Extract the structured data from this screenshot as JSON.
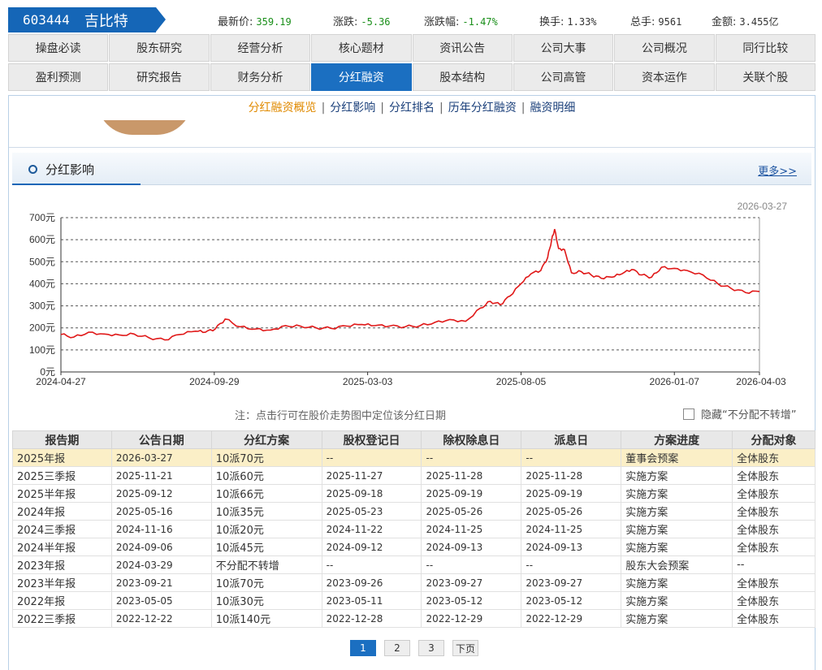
{
  "header": {
    "code": "603444",
    "name": "吉比特",
    "quotes": [
      {
        "label": "最新价:",
        "value": "359.19",
        "color": "green"
      },
      {
        "label": "涨跌:",
        "value": "-5.36",
        "color": "green"
      },
      {
        "label": "涨跌幅:",
        "value": "-1.47%",
        "color": "green"
      },
      {
        "label": "换手:",
        "value": "1.33%",
        "color": "plain"
      },
      {
        "label": "总手:",
        "value": "9561",
        "color": "plain"
      },
      {
        "label": "金额:",
        "value": "3.455亿",
        "color": "plain"
      }
    ]
  },
  "nav_row1": [
    "操盘必读",
    "股东研究",
    "经营分析",
    "核心题材",
    "资讯公告",
    "公司大事",
    "公司概况",
    "同行比较"
  ],
  "nav_row2": [
    "盈利预测",
    "研究报告",
    "财务分析",
    "分红融资",
    "股本结构",
    "公司高管",
    "资本运作",
    "关联个股"
  ],
  "nav_active": "分红融资",
  "subnav": [
    "分红融资概览",
    "分红影响",
    "分红排名",
    "历年分红融资",
    "融资明细"
  ],
  "section": {
    "title": "分红影响",
    "more": "更多>>"
  },
  "chart_data": {
    "type": "line",
    "date_label": "2026-03-27",
    "y_ticks": [
      "0元",
      "100元",
      "200元",
      "300元",
      "400元",
      "500元",
      "600元",
      "700元"
    ],
    "x_ticks": [
      "2024-04-27",
      "2024-09-29",
      "2025-03-03",
      "2025-08-05",
      "2026-01-07",
      "2026-04-03"
    ],
    "ylim": [
      0,
      700
    ],
    "grid": true,
    "line_color": "#e01818",
    "x_dates": [
      "2024-04-27",
      "2024-05-10",
      "2024-05-25",
      "2024-06-10",
      "2024-06-25",
      "2024-07-10",
      "2024-07-25",
      "2024-08-10",
      "2024-08-25",
      "2024-09-10",
      "2024-09-20",
      "2024-09-30",
      "2024-10-10",
      "2024-10-25",
      "2024-11-10",
      "2024-11-25",
      "2024-12-10",
      "2024-12-25",
      "2025-01-10",
      "2025-01-25",
      "2025-02-10",
      "2025-02-25",
      "2025-03-10",
      "2025-03-25",
      "2025-04-10",
      "2025-04-25",
      "2025-05-10",
      "2025-05-25",
      "2025-06-10",
      "2025-06-25",
      "2025-07-05",
      "2025-07-15",
      "2025-07-25",
      "2025-08-05",
      "2025-08-15",
      "2025-08-25",
      "2025-09-01",
      "2025-09-05",
      "2025-09-08",
      "2025-09-12",
      "2025-09-18",
      "2025-09-25",
      "2025-10-05",
      "2025-10-15",
      "2025-10-25",
      "2025-11-05",
      "2025-11-15",
      "2025-11-25",
      "2025-12-05",
      "2025-12-15",
      "2025-12-25",
      "2026-01-07",
      "2026-01-20",
      "2026-02-05",
      "2026-02-20",
      "2026-03-05",
      "2026-03-20",
      "2026-04-03"
    ],
    "values": [
      170,
      158,
      180,
      172,
      168,
      172,
      155,
      145,
      170,
      185,
      180,
      195,
      240,
      205,
      195,
      190,
      210,
      208,
      200,
      198,
      208,
      215,
      210,
      208,
      205,
      210,
      225,
      238,
      230,
      290,
      320,
      305,
      345,
      400,
      445,
      460,
      520,
      600,
      648,
      560,
      555,
      450,
      455,
      440,
      425,
      430,
      445,
      465,
      440,
      430,
      475,
      470,
      460,
      440,
      400,
      380,
      360,
      365
    ]
  },
  "note": "注：点击行可在股价走势图中定位该分红日期",
  "hide_label": "隐藏“不分配不转增”",
  "table": {
    "headers": [
      "报告期",
      "公告日期",
      "分红方案",
      "股权登记日",
      "除权除息日",
      "派息日",
      "方案进度",
      "分配对象"
    ],
    "rows": [
      [
        "2025年报",
        "2026-03-27",
        "10派70元",
        "--",
        "--",
        "--",
        "董事会预案",
        "全体股东"
      ],
      [
        "2025三季报",
        "2025-11-21",
        "10派60元",
        "2025-11-27",
        "2025-11-28",
        "2025-11-28",
        "实施方案",
        "全体股东"
      ],
      [
        "2025半年报",
        "2025-09-12",
        "10派66元",
        "2025-09-18",
        "2025-09-19",
        "2025-09-19",
        "实施方案",
        "全体股东"
      ],
      [
        "2024年报",
        "2025-05-16",
        "10派35元",
        "2025-05-23",
        "2025-05-26",
        "2025-05-26",
        "实施方案",
        "全体股东"
      ],
      [
        "2024三季报",
        "2024-11-16",
        "10派20元",
        "2024-11-22",
        "2024-11-25",
        "2024-11-25",
        "实施方案",
        "全体股东"
      ],
      [
        "2024半年报",
        "2024-09-06",
        "10派45元",
        "2024-09-12",
        "2024-09-13",
        "2024-09-13",
        "实施方案",
        "全体股东"
      ],
      [
        "2023年报",
        "2024-03-29",
        "不分配不转增",
        "--",
        "--",
        "--",
        "股东大会预案",
        "--"
      ],
      [
        "2023半年报",
        "2023-09-21",
        "10派70元",
        "2023-09-26",
        "2023-09-27",
        "2023-09-27",
        "实施方案",
        "全体股东"
      ],
      [
        "2022年报",
        "2023-05-05",
        "10派30元",
        "2023-05-11",
        "2023-05-12",
        "2023-05-12",
        "实施方案",
        "全体股东"
      ],
      [
        "2022三季报",
        "2022-12-22",
        "10派140元",
        "2022-12-28",
        "2022-12-29",
        "2022-12-29",
        "实施方案",
        "全体股东"
      ]
    ]
  },
  "pager": [
    "1",
    "2",
    "3",
    "下页"
  ]
}
